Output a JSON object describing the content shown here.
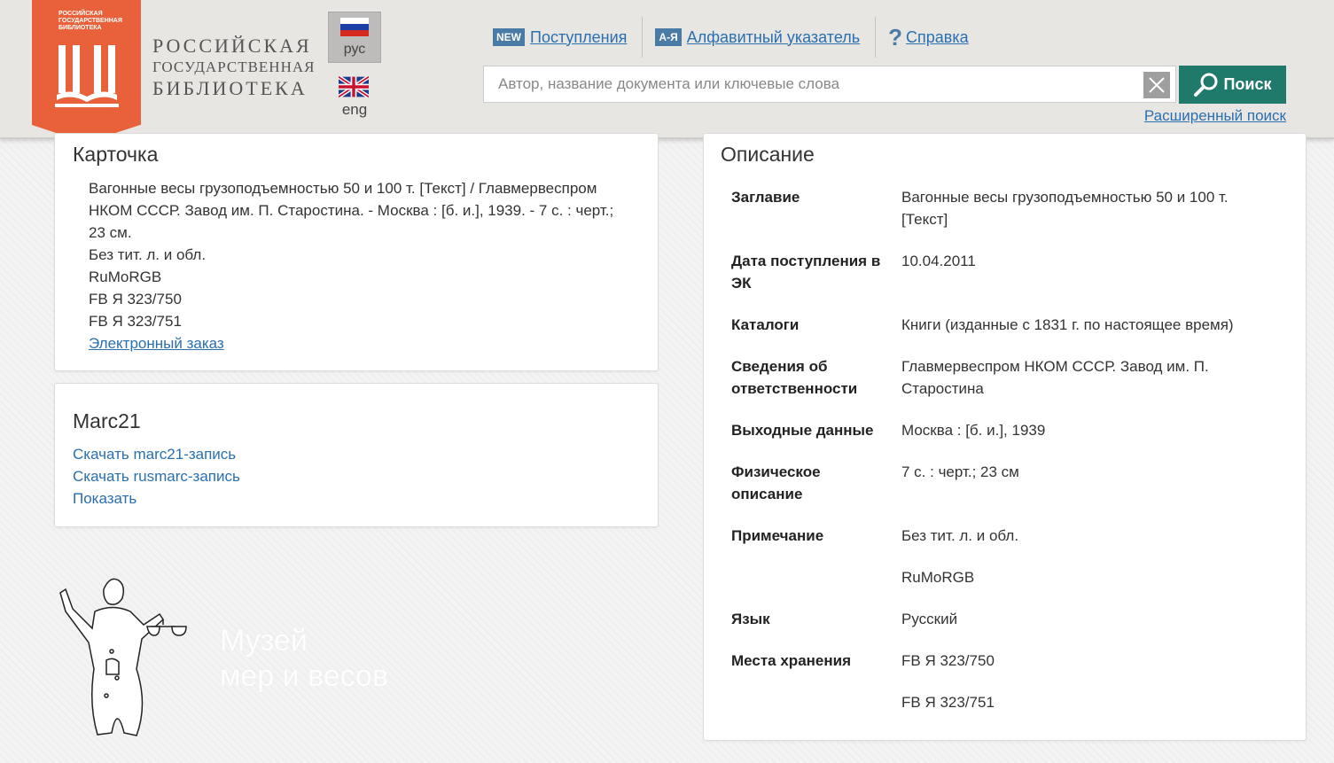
{
  "header": {
    "logo_small_text": "РОССИЙСКАЯ ГОСУДАРСТВЕННАЯ БИБЛИОТЕКА",
    "logo_line1": "РОССИЙСКАЯ",
    "logo_line2": "ГОСУДАРСТВЕННАЯ",
    "logo_line3": "БИБЛИОТЕКА",
    "lang_ru": "рус",
    "lang_en": "eng",
    "nav": {
      "new_badge": "NEW",
      "new_label": "Поступления",
      "az_badge": "А-Я",
      "az_label": "Алфавитный указатель",
      "help_label": "Справка"
    },
    "search_placeholder": "Автор, название документа или ключевые слова",
    "search_button": "Поиск",
    "advanced_search": "Расширенный поиск"
  },
  "card": {
    "title": "Карточка",
    "lines": [
      "Вагонные весы грузоподъемностью 50 и 100 т. [Текст] / Главмервеспром НКОМ СССР. Завод им. П. Старостина. - Москва : [б. и.], 1939. - 7 с. : черт.; 23 см.",
      "Без тит. л. и обл.",
      "RuMoRGB",
      "FB Я 323/750",
      "FB Я 323/751"
    ],
    "order_link": "Электронный заказ"
  },
  "marc": {
    "title": "Marc21",
    "links": [
      "Скачать marc21-запись",
      "Скачать rusmarc-запись",
      "Показать"
    ]
  },
  "description": {
    "title": "Описание",
    "rows": [
      {
        "key": "Заглавие",
        "value": "Вагонные весы грузоподъемностью 50 и 100 т. [Текст]"
      },
      {
        "key": "Дата поступления в ЭК",
        "value": "10.04.2011"
      },
      {
        "key": "Каталоги",
        "value": "Книги (изданные с 1831 г. по настоящее время)"
      },
      {
        "key": "Сведения об ответственности",
        "value": "Главмервеспром НКОМ СССР. Завод им. П. Старостина"
      },
      {
        "key": "Выходные данные",
        "value": "Москва : [б. и.], 1939"
      },
      {
        "key": "Физическое описание",
        "value": "7 с. : черт.; 23 см"
      },
      {
        "key": "Примечание",
        "value": "Без тит. л. и обл."
      },
      {
        "key": "",
        "value": "RuMoRGB"
      },
      {
        "key": "Язык",
        "value": "Русский"
      },
      {
        "key": "Места хранения",
        "value": "FB Я 323/750"
      },
      {
        "key": "",
        "value": "FB Я 323/751"
      }
    ]
  },
  "museum": {
    "line1": "Музей",
    "line2": "мер и весов"
  },
  "colors": {
    "accent": "#e8613a",
    "search_button": "#1f7a6b",
    "link": "#2a6fb0",
    "badge": "#4a7aa6"
  }
}
